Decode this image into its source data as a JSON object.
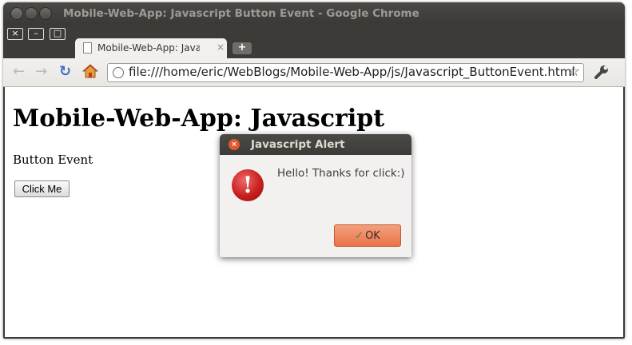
{
  "window": {
    "title": "Mobile-Web-App: Javascript Button Event - Google Chrome",
    "controls": {
      "close": "×",
      "minimize": "–",
      "maximize": "□"
    }
  },
  "tabs": [
    {
      "label": "Mobile-Web-App: Javascript",
      "close": "×"
    }
  ],
  "new_tab_label": "+",
  "toolbar": {
    "url": "file:///home/eric/WebBlogs/Mobile-Web-App/js/Javascript_ButtonEvent.html",
    "back_icon": "←",
    "forward_icon": "→",
    "reload_icon": "↻",
    "star_icon": "☆"
  },
  "page": {
    "heading": "Mobile-Web-App: Javascript",
    "subtitle": "Button Event",
    "button_label": "Click Me"
  },
  "alert": {
    "title": "Javascript Alert",
    "close": "×",
    "icon_glyph": "!",
    "message": "Hello! Thanks for click:)",
    "ok_check": "✓",
    "ok_label": "OK",
    "ok_color": "#e9744a"
  }
}
